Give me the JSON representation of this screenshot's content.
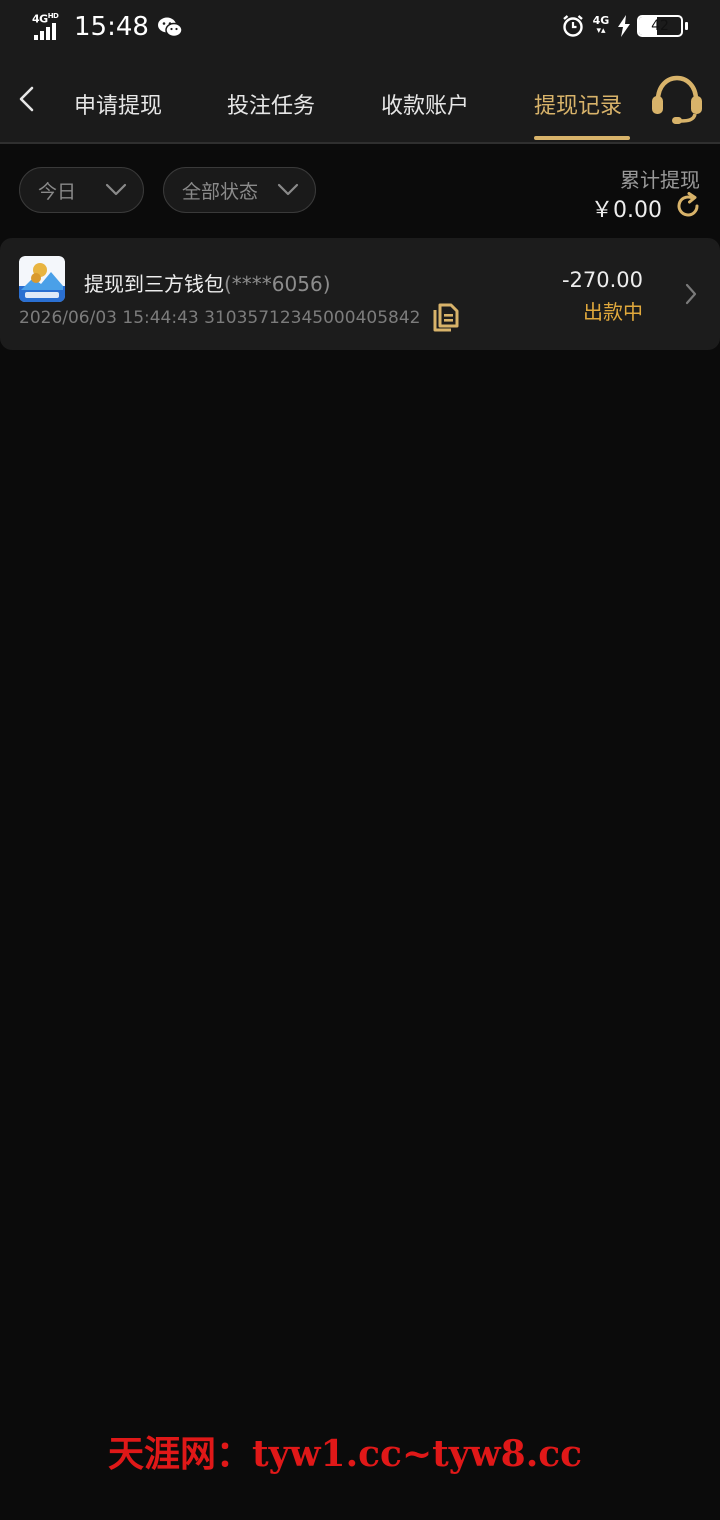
{
  "status_bar": {
    "network": "4G",
    "network_hd": "HD",
    "time": "15:48",
    "network_right": "4G",
    "battery": "42",
    "battery_level": 0.42
  },
  "tabs": {
    "back_icon": "chevron-left-icon",
    "items": [
      "申请提现",
      "投注任务",
      "收款账户",
      "提现记录"
    ],
    "active_index": 3,
    "support_icon": "headset-icon"
  },
  "filters": {
    "date": "今日",
    "status": "全部状态"
  },
  "summary": {
    "label": "累计提现",
    "amount": "￥0.00"
  },
  "record": {
    "title": "提现到三方钱包",
    "account_mask": "(****6056)",
    "meta": "2026/06/03 15:44:43 31035712345000405842",
    "amount": "-270.00",
    "status": "出款中"
  },
  "watermark": "天涯网：tyw1.cc~tyw8.cc",
  "colors": {
    "accent": "#d8b36a",
    "status_pending": "#e0a83c",
    "watermark": "#e01818",
    "background": "#0b0b0b"
  }
}
